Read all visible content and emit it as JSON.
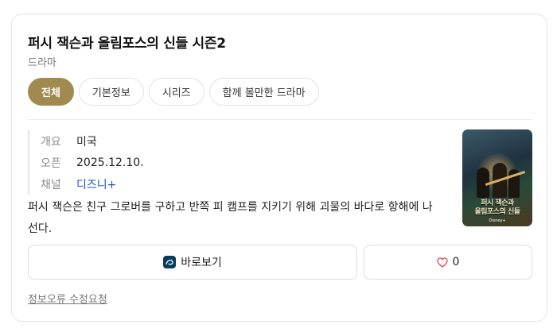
{
  "header": {
    "title": "퍼시 잭슨과 올림포스의 신들 시즌2",
    "subtitle": "드라마"
  },
  "tabs": [
    {
      "label": "전체",
      "active": true
    },
    {
      "label": "기본정보",
      "active": false
    },
    {
      "label": "시리즈",
      "active": false
    },
    {
      "label": "함께 볼만한 드라마",
      "active": false
    }
  ],
  "info": {
    "rows": [
      {
        "label": "개요",
        "value": "미국"
      },
      {
        "label": "오픈",
        "value": "2025.12.10."
      },
      {
        "label": "채널",
        "value": "디즈니+"
      }
    ]
  },
  "description": "퍼시 잭슨은 친구 그로버를 구하고 반쪽 피 캠프를 지키기 위해 괴물의 바다로 항해에 나선다.",
  "poster": {
    "title_line1": "퍼시 잭슨과",
    "title_line2": "올림포스의 신들",
    "brand": "Disney+"
  },
  "actions": {
    "watch_label": "바로보기",
    "like_count": "0"
  },
  "footer": {
    "report_label": "정보오류 수정요청"
  },
  "colors": {
    "accent": "#a08a4f",
    "link": "#1a55c7",
    "heart": "#e0455a"
  },
  "icons": {
    "watch": "disney-plus-icon",
    "like": "heart-icon"
  }
}
